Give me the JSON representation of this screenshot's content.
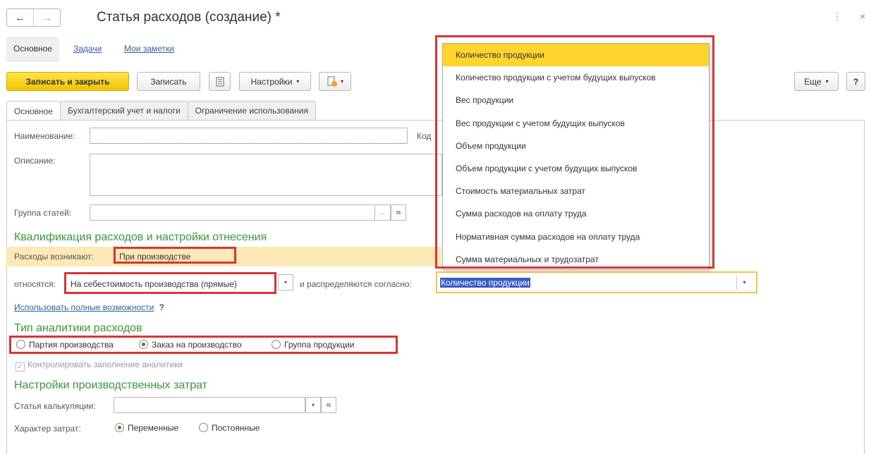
{
  "window": {
    "title": "Статья расходов (создание) *",
    "back": "←",
    "forward": "→",
    "menu": "⋮",
    "close": "×"
  },
  "subtabs": [
    "Основное",
    "Задачи",
    "Мои заметки"
  ],
  "toolbar": {
    "save_close": "Записать и закрыть",
    "save": "Записать",
    "settings": "Настройки",
    "more": "Еще",
    "help": "?"
  },
  "tabs": [
    "Основное",
    "Бухгалтерский учет и налоги",
    "Ограничение использования"
  ],
  "form": {
    "name_label": "Наименование:",
    "code_label": "Код",
    "desc_label": "Описание:",
    "group_label": "Группа статей:",
    "dots": "...",
    "section1": "Квалификация расходов и настройки отнесения",
    "arise_label": "Расходы возникают:",
    "arise_value": "При производстве",
    "relate_label": "относятся:",
    "relate_value": "На себестоимость производства (прямые)",
    "distrib_label": "и распределяются согласно:",
    "distrib_value": "Количество продукции",
    "use_full": "Использовать полные возможности",
    "use_full_q": "?",
    "section2": "Тип аналитики расходов",
    "analytics": [
      {
        "label": "Партия производства",
        "on": false
      },
      {
        "label": "Заказ на производство",
        "on": true
      },
      {
        "label": "Группа продукции",
        "on": false
      }
    ],
    "control_label": "Контролировать заполнение аналитики",
    "section3": "Настройки производственных затрат",
    "calc_label": "Статья калькуляции:",
    "nature_label": "Характер затрат:",
    "nature": [
      {
        "label": "Переменные",
        "on": true
      },
      {
        "label": "Постоянные",
        "on": false
      }
    ]
  },
  "dropdown": {
    "items": [
      "Количество продукции",
      "Количество продукции с учетом будущих выпусков",
      "Вес продукции",
      "Вес продукции с учетом будущих выпусков",
      "Объем продукции",
      "Объем продукции с учетом будущих выпусков",
      "Стоимость материальных затрат",
      "Сумма расходов на оплату труда",
      "Нормативная сумма расходов на оплату труда",
      "Сумма материальных и трудозатрат"
    ],
    "selected": 0
  },
  "colors": {
    "accent_yellow": "#ffd42c",
    "highlight_red": "#d33333",
    "section_green": "#3a9a3a",
    "link_blue": "#2d62a8"
  }
}
